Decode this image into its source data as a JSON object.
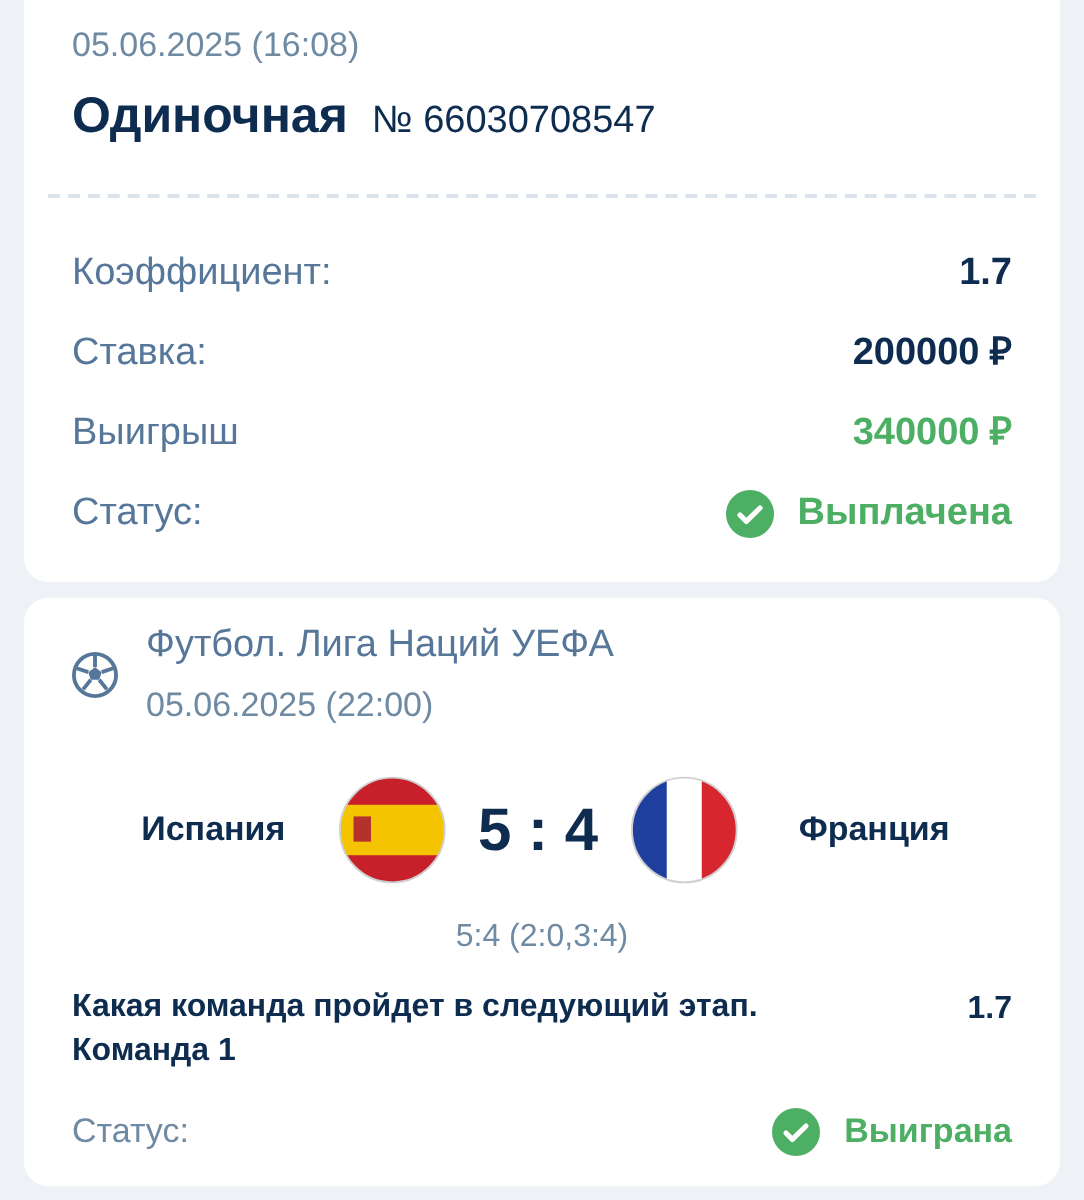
{
  "bet": {
    "date": "05.06.2025 (16:08)",
    "type": "Одиночная",
    "number": "№ 66030708547"
  },
  "details": [
    {
      "kind": "value",
      "label": "Коэффициент:",
      "value": "1.7"
    },
    {
      "kind": "value",
      "label": "Ставка:",
      "value": "200000 ₽"
    },
    {
      "kind": "win",
      "label": "Выигрыш",
      "value": "340000 ₽"
    },
    {
      "kind": "status",
      "label": "Статус:",
      "value": "Выплачена"
    }
  ],
  "event": {
    "league": "Футбол. Лига Наций УЕФА",
    "date": "05.06.2025 (22:00)",
    "teams": [
      {
        "name": "Испания",
        "kind": "spain"
      },
      {
        "name": "Франция",
        "kind": "france"
      }
    ],
    "score": "5 : 4",
    "score_detail": "5:4 (2:0,3:4)",
    "market": "Какая команда пройдет в следующий этап. Команда 1",
    "odds": "1.7",
    "status_label": "Статус:",
    "status": "Выиграна"
  }
}
